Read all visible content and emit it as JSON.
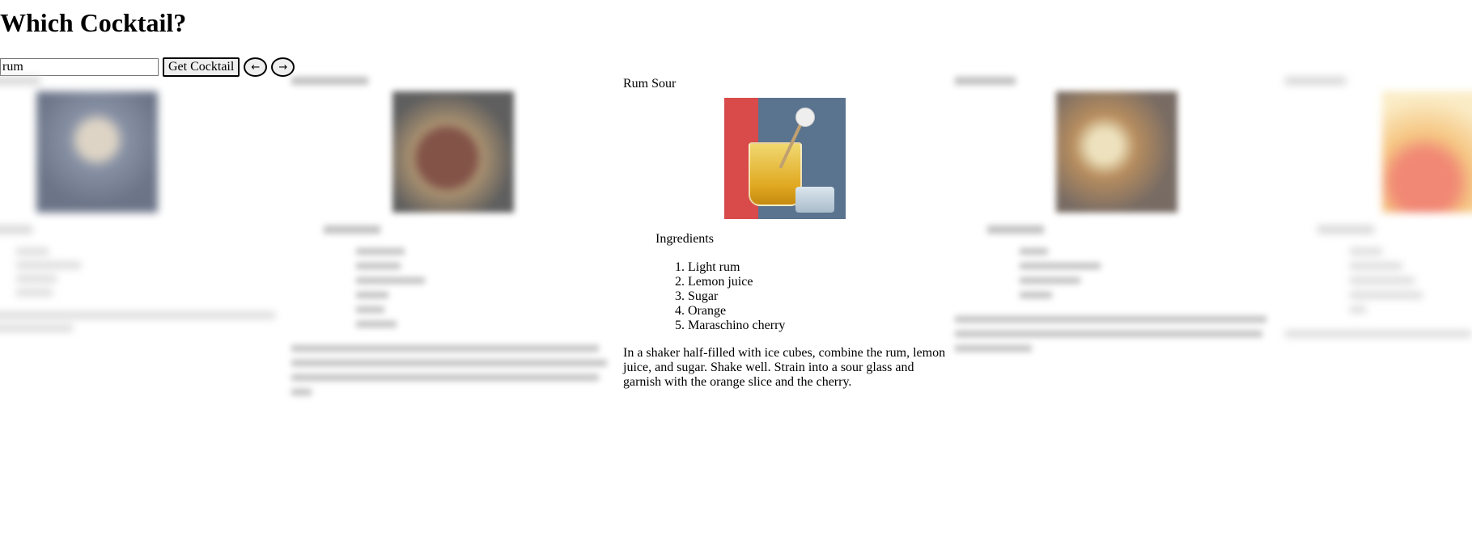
{
  "page": {
    "title": "Which Cocktail?"
  },
  "search": {
    "value": "rum"
  },
  "controls": {
    "get_label": "Get Cocktail",
    "prev_label": "←",
    "next_label": "→"
  },
  "main_card": {
    "name": "Rum Sour",
    "image_icon": "rum-sour-photo",
    "ingredients_title": "Ingredients",
    "ingredients": [
      "Light rum",
      "Lemon juice",
      "Sugar",
      "Orange",
      "Maraschino cherry"
    ],
    "instructions": "In a shaker half-filled with ice cubes, combine the rum, lemon juice, and sugar. Shake well. Strain into a sour glass and garnish with the orange slice and the cherry."
  },
  "colors": {
    "accent": "#000000",
    "button_bg": "#efefef"
  }
}
